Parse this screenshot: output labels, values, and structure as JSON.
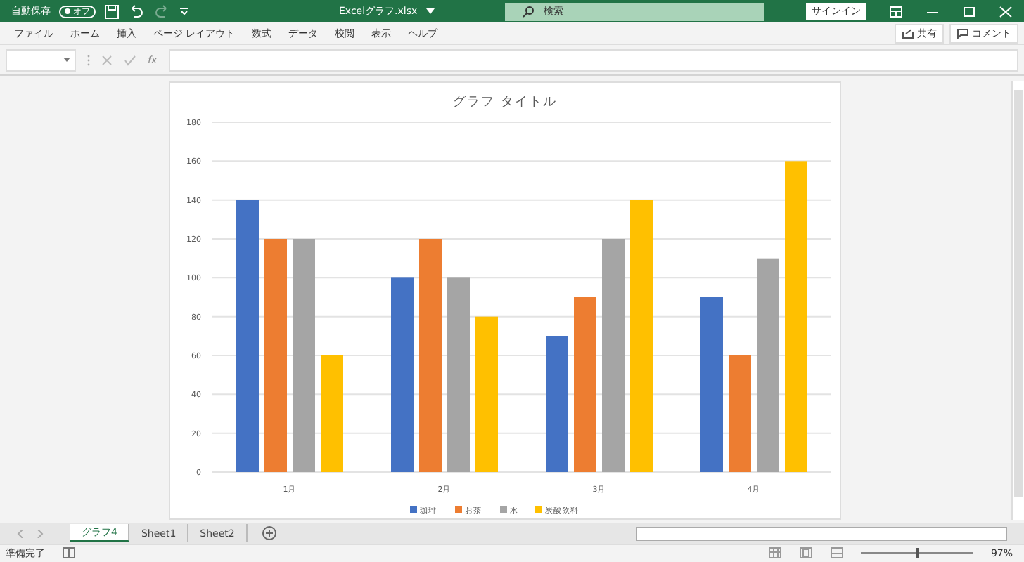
{
  "title_bar": {
    "autosave_label": "自動保存",
    "autosave_toggle": {
      "label": "オフ",
      "on": false
    },
    "filename": "Excelグラフ.xlsx",
    "search": {
      "placeholder": "検索"
    },
    "sign_in": "サインイン"
  },
  "menu": [
    {
      "label": "ファイル"
    },
    {
      "label": "ホーム"
    },
    {
      "label": "挿入"
    },
    {
      "label": "ページ レイアウト"
    },
    {
      "label": "数式"
    },
    {
      "label": "データ"
    },
    {
      "label": "校閲"
    },
    {
      "label": "表示"
    },
    {
      "label": "ヘルプ"
    }
  ],
  "ribbon_buttons": [
    "共有",
    "コメント"
  ],
  "formula_bar": {
    "fx": "fx"
  },
  "chart": {
    "chart_data": {
      "type": "bar",
      "title": "グラフ タイトル",
      "categories": [
        "1月",
        "2月",
        "3月",
        "4月"
      ],
      "series": [
        {
          "name": "珈琲",
          "color": "#4472c4",
          "values": [
            140,
            100,
            70,
            90
          ]
        },
        {
          "name": "お茶",
          "color": "#ed7d31",
          "values": [
            120,
            120,
            90,
            60
          ]
        },
        {
          "name": "水",
          "color": "#a5a5a5",
          "values": [
            120,
            100,
            120,
            110
          ]
        },
        {
          "name": "炭酸飲料",
          "color": "#ffc000",
          "values": [
            60,
            80,
            140,
            160
          ]
        }
      ],
      "grid": true,
      "legend": true,
      "ylim": [
        0,
        180
      ],
      "yticks": [
        0,
        20,
        40,
        60,
        80,
        100,
        120,
        140,
        160,
        180
      ]
    }
  },
  "sheet_tabs": [
    {
      "label": "グラフ4",
      "selected": true
    },
    {
      "label": "Sheet1",
      "selected": false
    },
    {
      "label": "Sheet2",
      "selected": false
    }
  ],
  "status_bar": {
    "status": "準備完了",
    "zoom": "97%",
    "level": 0.48
  }
}
